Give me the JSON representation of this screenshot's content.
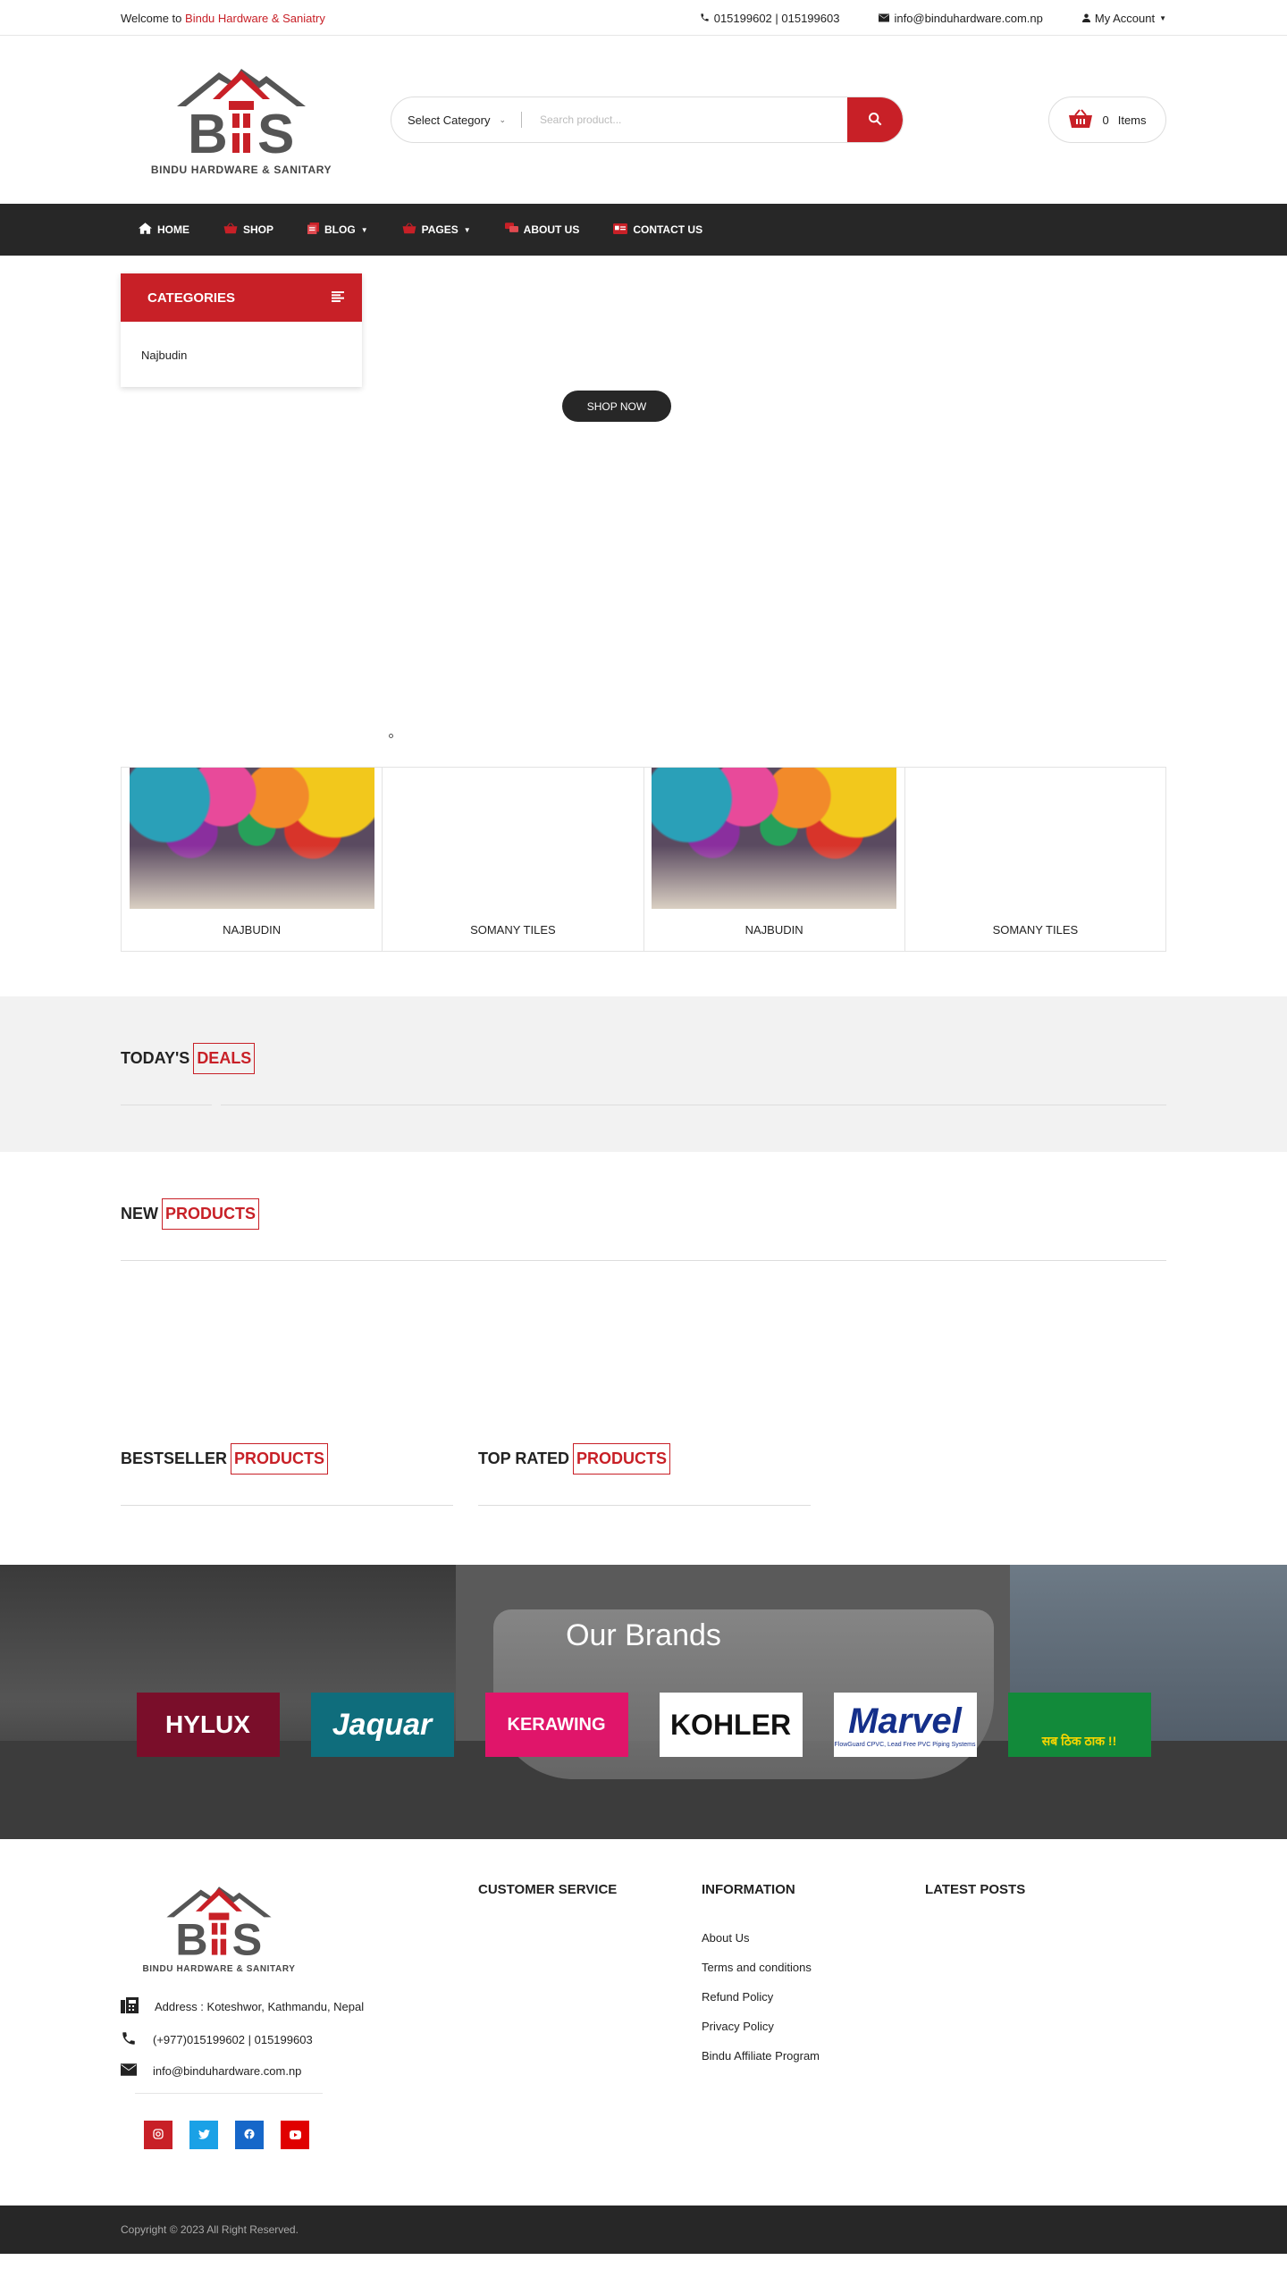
{
  "topbar": {
    "welcome_prefix": "Welcome to",
    "welcome_brand": "Bindu Hardware & Saniatry",
    "phones": "015199602 | 015199603",
    "email": "info@binduhardware.com.np",
    "account": "My Account"
  },
  "header": {
    "logo_text": "BINDU HARDWARE & SANITARY",
    "category_select": "Select Category",
    "search_placeholder": "Search product...",
    "cart_count": "0",
    "cart_label": "Items"
  },
  "nav": {
    "items": [
      {
        "label": "HOME"
      },
      {
        "label": "SHOP"
      },
      {
        "label": "BLOG"
      },
      {
        "label": "PAGES"
      },
      {
        "label": "ABOUT US"
      },
      {
        "label": "CONTACT US"
      }
    ]
  },
  "hero": {
    "categories_title": "CATEGORIES",
    "categories": [
      "Najbudin"
    ],
    "shop_now": "SHOP NOW"
  },
  "features": [
    {
      "label": "NAJBUDIN",
      "has_image": true
    },
    {
      "label": "SOMANY TILES",
      "has_image": false
    },
    {
      "label": "NAJBUDIN",
      "has_image": true
    },
    {
      "label": "SOMANY TILES",
      "has_image": false
    }
  ],
  "sections": {
    "deals": {
      "first": "TODAY'S",
      "second": "DEALS"
    },
    "new_products": {
      "first": "NEW",
      "second": "PRODUCTS"
    },
    "bestseller": {
      "first": "BESTSELLER",
      "second": "PRODUCTS"
    },
    "top_rated": {
      "first": "TOP RATED",
      "second": "PRODUCTS"
    }
  },
  "brands": {
    "title": "Our Brands",
    "items": [
      {
        "name": "HYLUX",
        "color": "#7a0e2a"
      },
      {
        "name": "Jaquar",
        "color": "#0f6d7c"
      },
      {
        "name": "KERAWING",
        "color": "#e0156a"
      },
      {
        "name": "KOHLER",
        "color": "#ffffff"
      },
      {
        "name": "Marvel",
        "color": "#ffffff"
      },
      {
        "name": "सब ठिक ठाक !!",
        "color": "#128a3a"
      }
    ],
    "marvel_sub": "FlowGuard CPVC, Lead Free PVC Piping Systems"
  },
  "footer": {
    "logo_text": "BINDU HARDWARE & SANITARY",
    "address": "Address : Koteshwor, Kathmandu, Nepal",
    "phone": "(+977)015199602 | 015199603",
    "email": "info@binduhardware.com.np",
    "customer_service": "CUSTOMER SERVICE",
    "information": "INFORMATION",
    "latest_posts": "LATEST POSTS",
    "info_links": [
      "About Us",
      "Terms and conditions",
      "Refund Policy",
      "Privacy Policy",
      "Bindu Affiliate Program"
    ],
    "copyright": "Copyright © 2023 All Right Reserved."
  },
  "colors": {
    "accent": "#c82027",
    "dark": "#272727"
  }
}
